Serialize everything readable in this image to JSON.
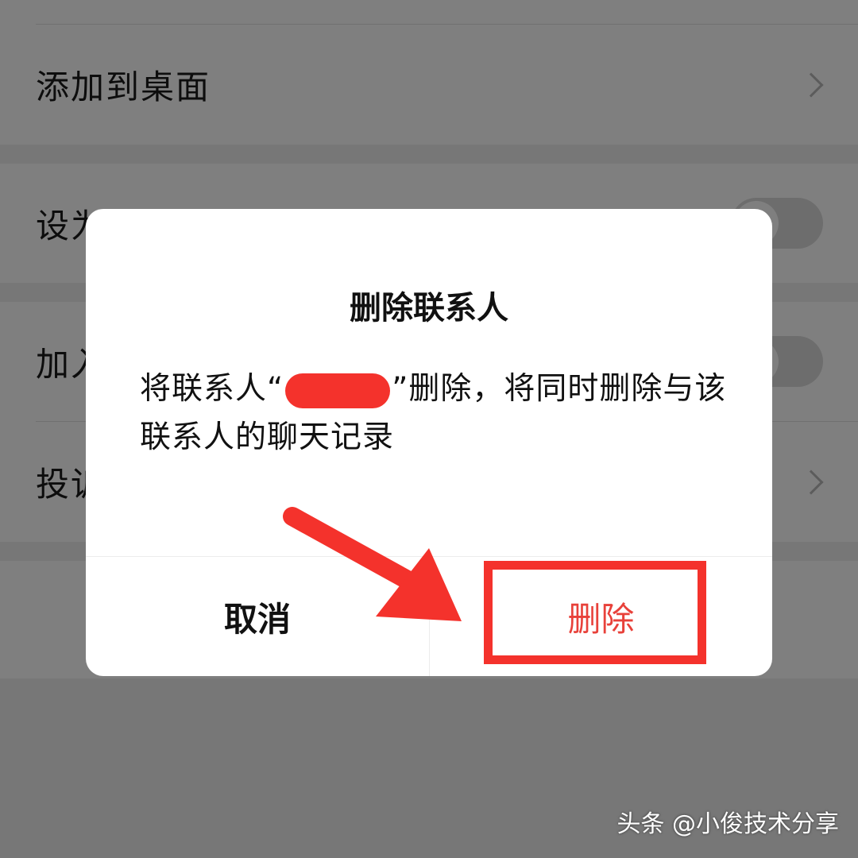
{
  "settings": {
    "rows": [
      {
        "label": "添加到桌面",
        "control": "chevron"
      },
      {
        "label": "设为星标朋友",
        "control": "toggle"
      },
      {
        "label": "加入黑名单",
        "control": "toggle"
      },
      {
        "label": "投诉",
        "control": "chevron"
      }
    ]
  },
  "dialog": {
    "title": "删除联系人",
    "message_before": "将联系人“",
    "message_after": "”删除，将同时删除与该联系人的聊天记录",
    "cancel_label": "取消",
    "delete_label": "删除"
  },
  "watermark": "头条 @小俊技术分享",
  "colors": {
    "danger": "#e8413a",
    "annotation": "#f4322c",
    "dim_overlay": "rgba(0,0,0,0.5)"
  }
}
